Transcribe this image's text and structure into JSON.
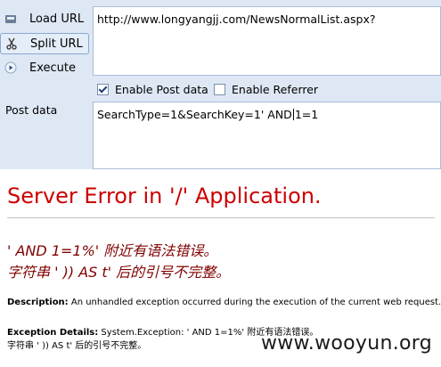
{
  "hackbar": {
    "load_url_label": "Load URL",
    "split_url_label": "Split URL",
    "execute_label": "Execute",
    "url_value": "http://www.longyangjj.com/NewsNormalList.aspx?",
    "enable_post_label": "Enable Post data",
    "enable_post_checked": true,
    "enable_referrer_label": "Enable Referrer",
    "enable_referrer_checked": false,
    "post_label": "Post data",
    "post_value_before_caret": "SearchType=1&SearchKey=1'  AND",
    "post_value_after_caret": "1=1"
  },
  "error_page": {
    "title": "Server Error in '/' Application.",
    "message_line1": "'  AND 1=1%' 附近有语法错误。",
    "message_line2": "字符串 ' )) AS t' 后的引号不完整。",
    "description_label": "Description:",
    "description_text": " An unhandled exception occurred during the execution of the current web request.",
    "exception_label": "Exception Details:",
    "exception_text_line1": " System.Exception: '  AND 1=1%' 附近有语法错误。",
    "exception_text_line2": "字符串 ' )) AS t' 后的引号不完整。"
  },
  "watermark": "www.wooyun.org",
  "icons": {
    "load": "load-url-icon",
    "split": "scissors-icon",
    "execute": "play-icon"
  },
  "colors": {
    "toolbar_bg": "#dee8f5",
    "error_title": "#cc0000",
    "error_message": "#800000"
  }
}
